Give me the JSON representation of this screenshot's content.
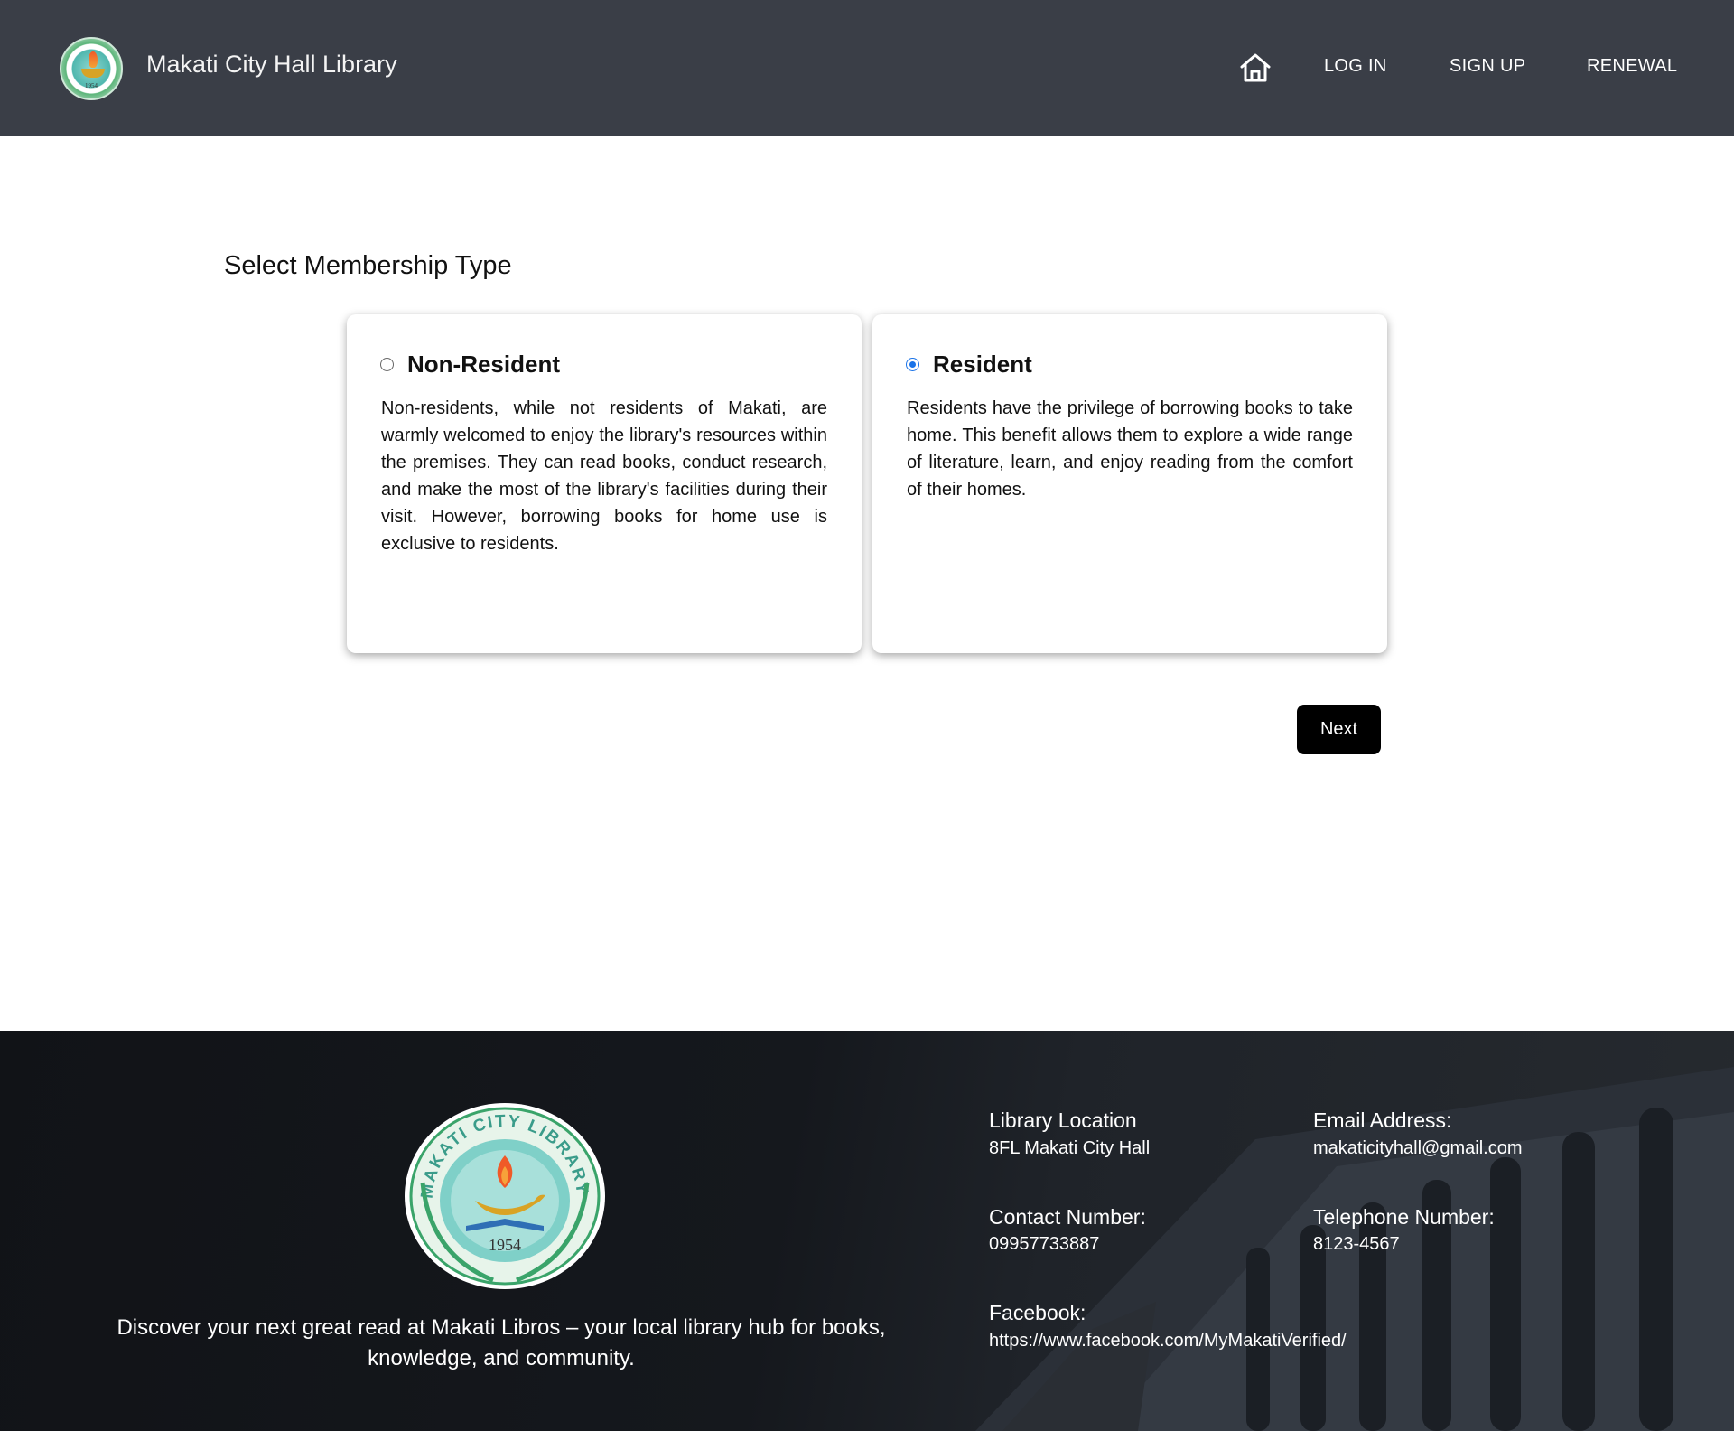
{
  "header": {
    "brand_title": "Makati City Hall Library",
    "logo_year": "1954",
    "nav": {
      "home_icon": "home-icon",
      "login": "LOG IN",
      "signup": "SIGN UP",
      "renewal": "RENEWAL"
    }
  },
  "main": {
    "heading": "Select Membership Type",
    "options": [
      {
        "title": "Non-Resident",
        "selected": false,
        "description": "Non-residents, while not residents of Makati, are warmly welcomed to enjoy the library's resources within the premises. They can read books, conduct research, and make the most of the library's facilities during their visit. However, borrowing books for home use is exclusive to residents."
      },
      {
        "title": "Resident",
        "selected": true,
        "description": "Residents have the privilege of borrowing books to take home. This benefit allows them to explore a wide range of literature, learn, and enjoy reading from the comfort of their homes."
      }
    ],
    "next_label": "Next"
  },
  "footer": {
    "logo_text": "MAKATI CITY LIBRARY",
    "logo_year": "1954",
    "tagline": "Discover your next great read at Makati Libros – your local library hub for books, knowledge, and community.",
    "location_label": "Library Location",
    "location_value": "8FL Makati City Hall",
    "email_label": "Email Address:",
    "email_value": "makaticityhall@gmail.com",
    "contact_label": "Contact Number:",
    "contact_value": "09957733887",
    "telephone_label": "Telephone Number:",
    "telephone_value": "8123-4567",
    "facebook_label": "Facebook:",
    "facebook_value": "https://www.facebook.com/MyMakatiVerified/"
  },
  "colors": {
    "header_bg": "#3a3e47",
    "radio_selected": "#1a73e8",
    "button_bg": "#000000"
  }
}
